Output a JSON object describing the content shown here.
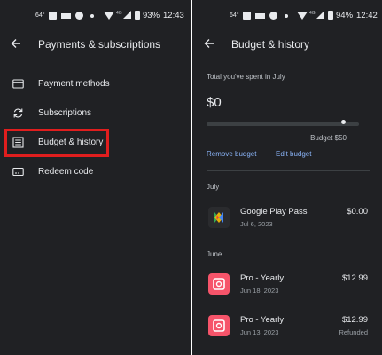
{
  "left_screen": {
    "status_bar": {
      "temperature": "64°",
      "battery_percent": "93%",
      "time": "12:43",
      "network": "4G"
    },
    "title": "Payments & subscriptions",
    "menu": [
      {
        "label": "Payment methods",
        "icon": "credit-card-icon"
      },
      {
        "label": "Subscriptions",
        "icon": "sync-icon"
      },
      {
        "label": "Budget & history",
        "icon": "list-icon",
        "highlighted": true
      },
      {
        "label": "Redeem code",
        "icon": "gift-card-icon"
      }
    ]
  },
  "right_screen": {
    "status_bar": {
      "temperature": "64°",
      "battery_percent": "94%",
      "time": "12:42",
      "network": "4G"
    },
    "title": "Budget & history",
    "spent_label": "Total you've spent in July",
    "spent_amount": "$0",
    "budget_progress": 0.0,
    "budget_limit": "Budget $50",
    "remove_budget": "Remove budget",
    "edit_budget": "Edit budget",
    "sections": [
      {
        "header": "July",
        "transactions": [
          {
            "name": "Google Play Pass",
            "date": "Jul 6, 2023",
            "amount": "$0.00",
            "status": "",
            "icon": "google-play-pass-icon"
          }
        ]
      },
      {
        "header": "June",
        "transactions": [
          {
            "name": "Pro - Yearly",
            "date": "Jun 18, 2023",
            "amount": "$12.99",
            "status": "",
            "icon": "pro-app-icon"
          },
          {
            "name": "Pro - Yearly",
            "date": "Jun 13, 2023",
            "amount": "$12.99",
            "status": "Refunded",
            "icon": "pro-app-icon"
          }
        ]
      }
    ],
    "colors": {
      "background": "#202124",
      "accent": "#8ab4f8",
      "highlight": "#e01e1e"
    }
  }
}
